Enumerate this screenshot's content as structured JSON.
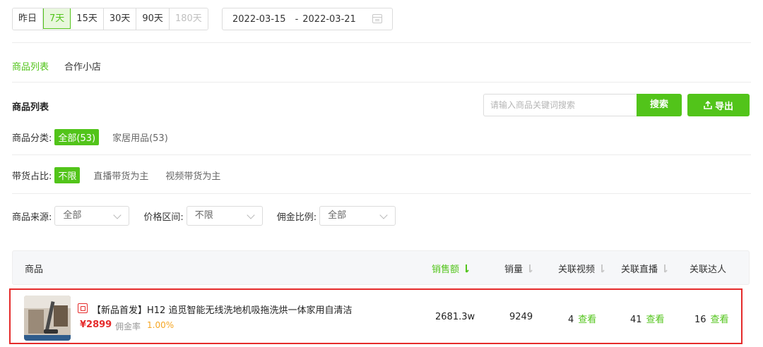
{
  "date_range": {
    "options": [
      {
        "label": "昨日",
        "state": "normal"
      },
      {
        "label": "7天",
        "state": "active"
      },
      {
        "label": "15天",
        "state": "normal"
      },
      {
        "label": "30天",
        "state": "normal"
      },
      {
        "label": "90天",
        "state": "normal"
      },
      {
        "label": "180天",
        "state": "disabled"
      }
    ],
    "start": "2022-03-15",
    "separator": "-",
    "end": "2022-03-21"
  },
  "tabs": [
    {
      "label": "商品列表",
      "active": true
    },
    {
      "label": "合作小店",
      "active": false
    }
  ],
  "section_title": "商品列表",
  "search": {
    "placeholder": "请输入商品关键词搜索",
    "button": "搜索"
  },
  "export": {
    "label": "导出"
  },
  "filters": {
    "category": {
      "label": "商品分类:",
      "options": [
        "全部(53)",
        "家居用品(53)"
      ]
    },
    "ratio": {
      "label": "带货占比:",
      "options": [
        "不限",
        "直播带货为主",
        "视频带货为主"
      ]
    },
    "source": {
      "label": "商品来源:",
      "value": "全部"
    },
    "price": {
      "label": "价格区间:",
      "value": "不限"
    },
    "commission": {
      "label": "佣金比例:",
      "value": "全部"
    }
  },
  "table": {
    "headers": {
      "product": "商品",
      "sales_amount": "销售额",
      "sales_volume": "销量",
      "videos": "关联视频",
      "lives": "关联直播",
      "influencers": "关联达人"
    },
    "rows": [
      {
        "name": "【新品首发】H12 追觅智能无线洗地机吸拖洗烘一体家用自清洁",
        "price": "¥2899",
        "commission_label": "佣金率",
        "commission_rate": "1.00%",
        "sales_amount": "2681.3w",
        "sales_volume": "9249",
        "videos": "4",
        "lives": "41",
        "influencers": "16",
        "view_label": "查看"
      }
    ]
  },
  "colors": {
    "accent": "#52c41a",
    "highlight_border": "#e52b2b",
    "price": "#e52b2b",
    "commission": "#f5a623"
  }
}
